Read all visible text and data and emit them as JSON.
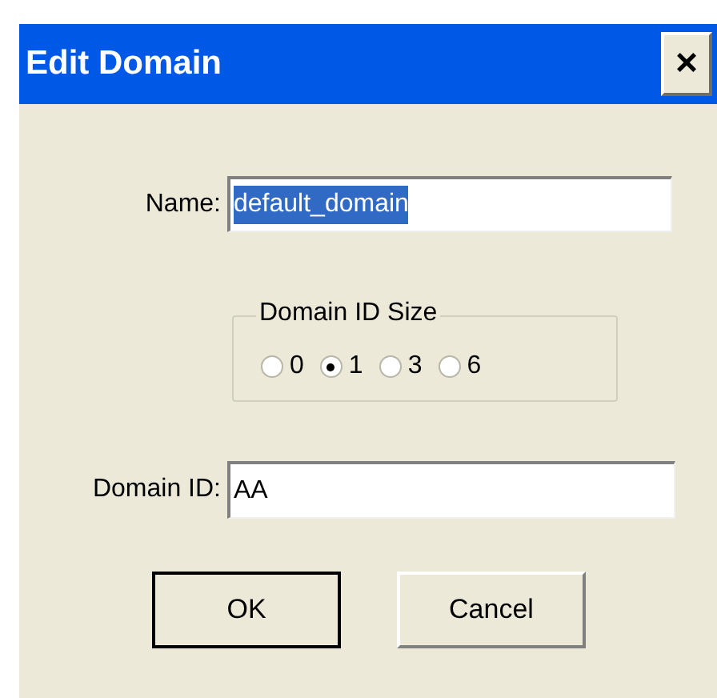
{
  "window": {
    "title": "Edit Domain",
    "close": "×"
  },
  "name_field": {
    "label": "Name:",
    "value": "default_domain",
    "selected": true
  },
  "id_size": {
    "title": "Domain ID Size",
    "options": [
      {
        "label": "0",
        "selected": false
      },
      {
        "label": "1",
        "selected": true
      },
      {
        "label": "3",
        "selected": false
      },
      {
        "label": "6",
        "selected": false
      }
    ]
  },
  "id_field": {
    "label": "Domain ID:",
    "value": "AA"
  },
  "buttons": [
    {
      "label": "OK",
      "default": true
    },
    {
      "label": "Cancel",
      "default": false
    }
  ]
}
